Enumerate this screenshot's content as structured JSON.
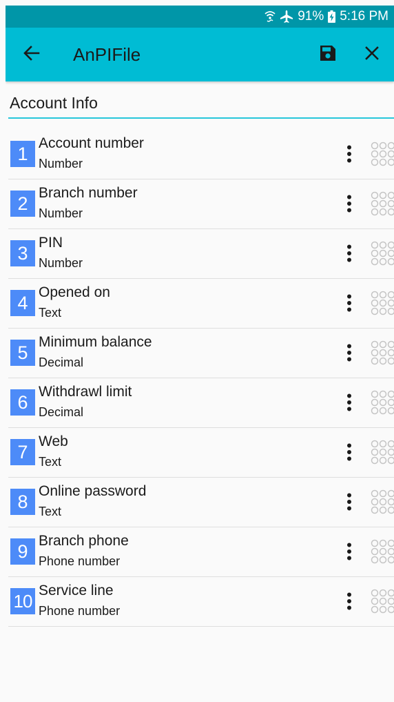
{
  "status_bar": {
    "battery": "91%",
    "time": "5:16 PM"
  },
  "app_bar": {
    "title": "AnPIFile"
  },
  "section": {
    "title": "Account Info"
  },
  "fields": [
    {
      "index": "1",
      "name": "Account number",
      "type": "Number"
    },
    {
      "index": "2",
      "name": "Branch number",
      "type": "Number"
    },
    {
      "index": "3",
      "name": "PIN",
      "type": "Number"
    },
    {
      "index": "4",
      "name": "Opened on",
      "type": "Text"
    },
    {
      "index": "5",
      "name": "Minimum balance",
      "type": "Decimal"
    },
    {
      "index": "6",
      "name": "Withdrawl limit",
      "type": "Decimal"
    },
    {
      "index": "7",
      "name": "Web",
      "type": "Text"
    },
    {
      "index": "8",
      "name": "Online password",
      "type": "Text"
    },
    {
      "index": "9",
      "name": "Branch phone",
      "type": "Phone number"
    },
    {
      "index": "10",
      "name": "Service line",
      "type": "Phone number"
    }
  ],
  "icons": {
    "status": [
      "wifi-calling-icon",
      "airplane-mode-icon",
      "battery-charging-icon"
    ],
    "app_bar": [
      "back-arrow-icon",
      "save-icon",
      "close-icon"
    ],
    "row": [
      "more-vert-icon",
      "drag-handle-icon"
    ]
  },
  "colors": {
    "status_bar": "#0096a8",
    "app_bar": "#00bcd4",
    "accent_line": "#26c6da",
    "index_badge": "#4d8bf8"
  }
}
